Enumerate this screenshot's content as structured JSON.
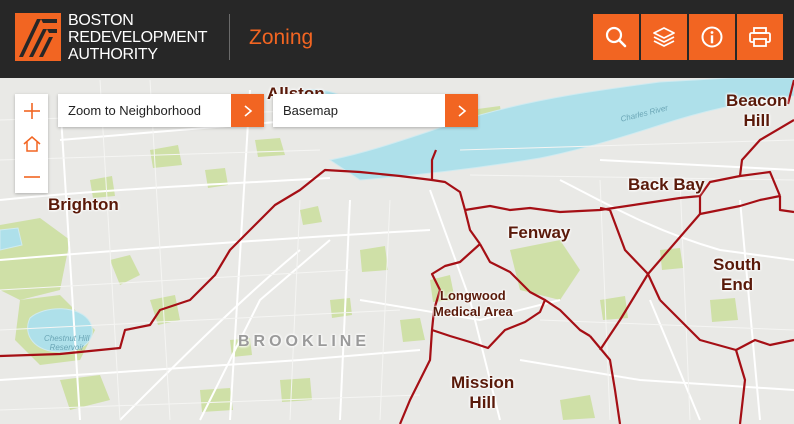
{
  "header": {
    "org_name_lines": [
      "BOSTON",
      "REDEVELOPMENT",
      "AUTHORITY"
    ],
    "app_title": "Zoning",
    "buttons": [
      {
        "icon": "search-icon"
      },
      {
        "icon": "layers-icon"
      },
      {
        "icon": "info-icon"
      },
      {
        "icon": "print-icon"
      }
    ]
  },
  "controls": {
    "zoom_in_icon": "plus-icon",
    "home_icon": "home-icon",
    "zoom_out_icon": "minus-icon",
    "neighborhood_dropdown": "Zoom to Neighborhood",
    "basemap_dropdown": "Basemap"
  },
  "map": {
    "neighborhoods": {
      "allston": "Allston",
      "brighton": "Brighton",
      "beacon_hill": [
        "Beacon",
        "Hill"
      ],
      "back_bay": "Back Bay",
      "fenway": "Fenway",
      "south_end": [
        "South",
        "End"
      ],
      "longwood": [
        "Longwood",
        "Medical Area"
      ],
      "mission_hill": [
        "Mission",
        "Hill"
      ]
    },
    "town": "BROOKLINE",
    "water_labels": {
      "charles_river": "Charles River",
      "chestnut_hill_reservoir": [
        "Chestnut Hill",
        "Reservoir"
      ]
    },
    "colors": {
      "accent": "#f26522",
      "header_bg": "#272727",
      "boundary": "#a50f15",
      "water": "#aee0ea",
      "park": "#cfe0a7",
      "land": "#e9e9e6"
    }
  }
}
